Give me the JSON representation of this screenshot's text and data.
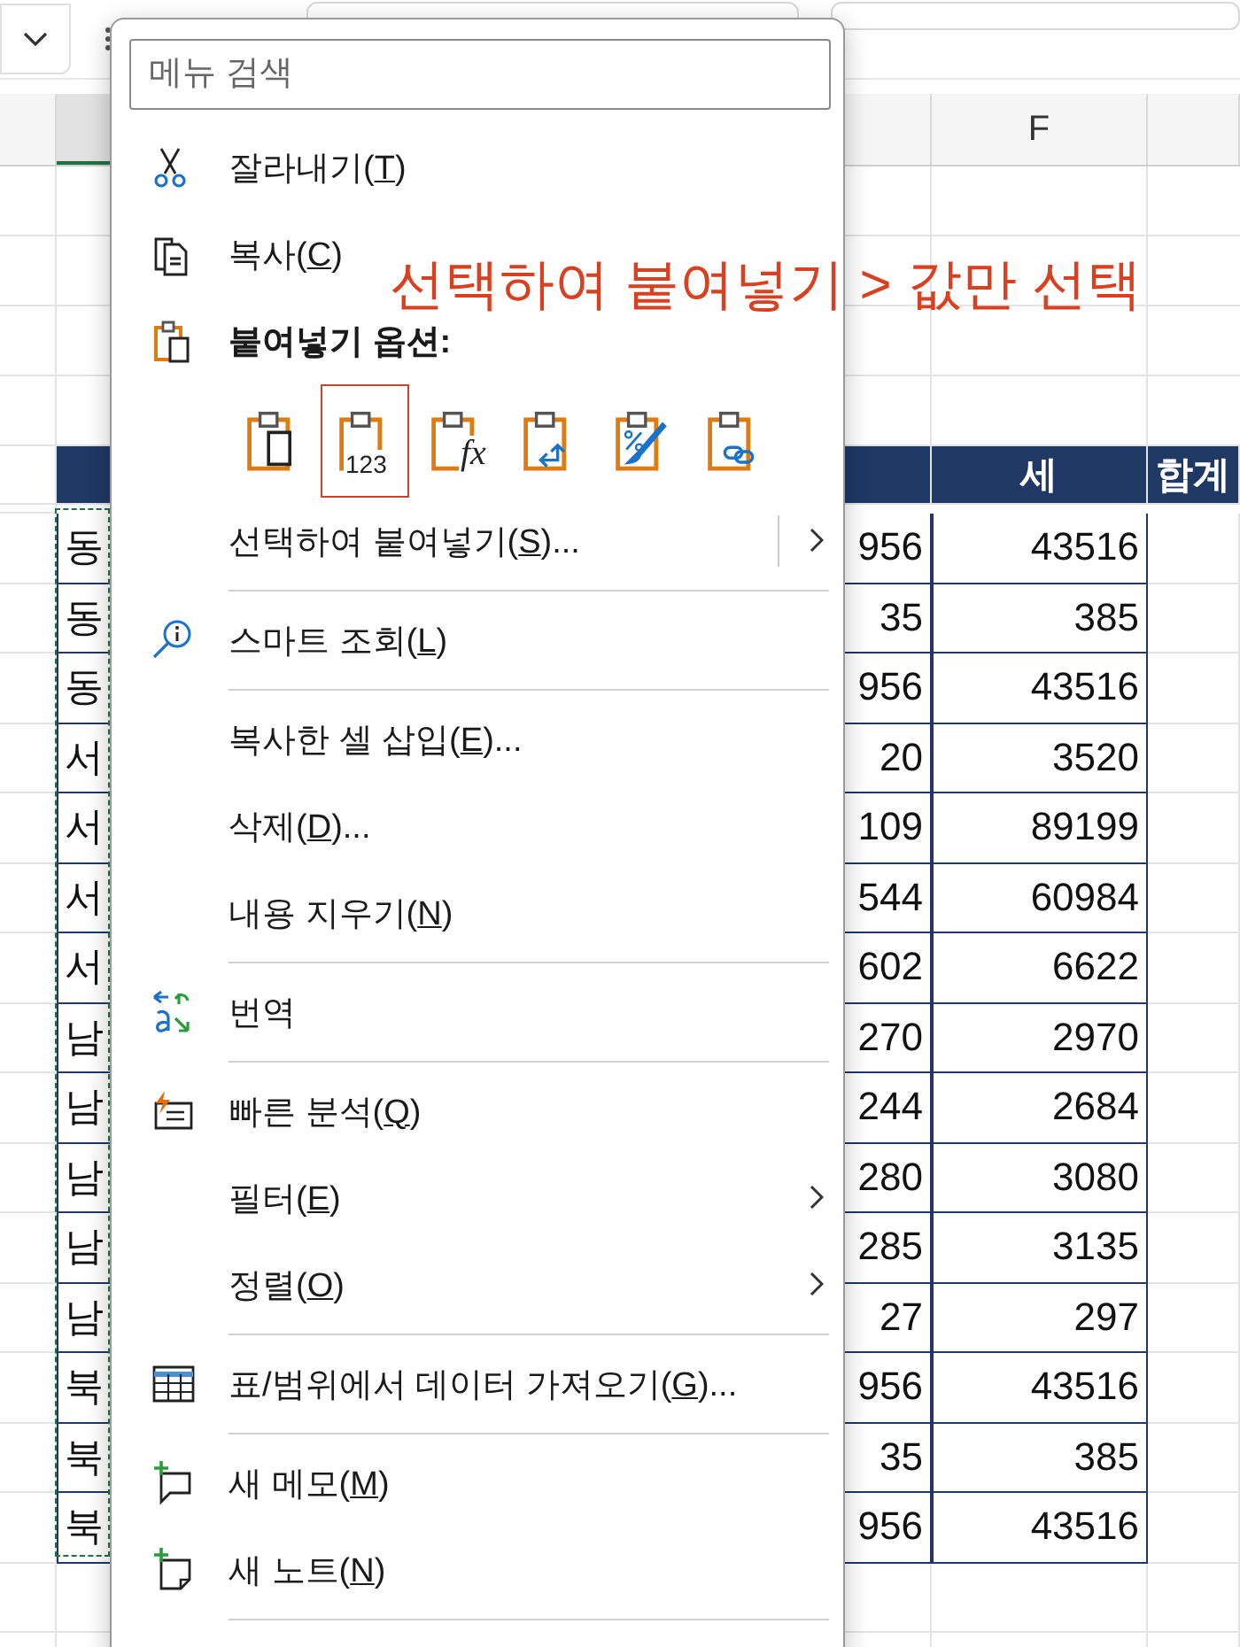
{
  "sheet": {
    "column_header": "F",
    "table_header": [
      "세",
      "합계"
    ],
    "rows": [
      {
        "column_a": "동",
        "column_e": "956",
        "total": "43516"
      },
      {
        "column_a": "동",
        "column_e": "35",
        "total": "385"
      },
      {
        "column_a": "동",
        "column_e": "956",
        "total": "43516"
      },
      {
        "column_a": "서",
        "column_e": "20",
        "total": "3520"
      },
      {
        "column_a": "서",
        "column_e": "109",
        "total": "89199"
      },
      {
        "column_a": "서",
        "column_e": "544",
        "total": "60984"
      },
      {
        "column_a": "서",
        "column_e": "602",
        "total": "6622"
      },
      {
        "column_a": "남",
        "column_e": "270",
        "total": "2970"
      },
      {
        "column_a": "남",
        "column_e": "244",
        "total": "2684"
      },
      {
        "column_a": "남",
        "column_e": "280",
        "total": "3080"
      },
      {
        "column_a": "남",
        "column_e": "285",
        "total": "3135"
      },
      {
        "column_a": "남",
        "column_e": "27",
        "total": "297"
      },
      {
        "column_a": "북",
        "column_e": "956",
        "total": "43516"
      },
      {
        "column_a": "북",
        "column_e": "35",
        "total": "385"
      },
      {
        "column_a": "북",
        "column_e": "956",
        "total": "43516"
      }
    ]
  },
  "context_menu": {
    "search": {
      "placeholder": "메뉴 검색"
    },
    "items": [
      {
        "kind": "item",
        "text": "잘라내기(",
        "key": "T",
        "rest": ")",
        "submenu": false,
        "split": false
      },
      {
        "kind": "item",
        "text": "복사(",
        "key": "C",
        "rest": ")",
        "submenu": false,
        "split": false
      },
      {
        "kind": "heading",
        "text": "붙여넣기 옵션:"
      },
      {
        "kind": "paste_options",
        "options": [
          {
            "annotated": false
          },
          {
            "label": "123",
            "annotated": true
          },
          {
            "label": "fx",
            "annotated": false
          },
          {
            "annotated": false
          },
          {
            "annotated": false
          },
          {
            "annotated": false
          }
        ]
      },
      {
        "kind": "item",
        "text": "선택하여 붙여넣기(",
        "key": "S",
        "rest": ")...",
        "submenu": true,
        "split": true
      },
      {
        "kind": "separator"
      },
      {
        "kind": "item",
        "text": "스마트 조회(",
        "key": "L",
        "rest": ")",
        "submenu": false,
        "split": false
      },
      {
        "kind": "separator"
      },
      {
        "kind": "item",
        "text": "복사한 셀 삽입(",
        "key": "E",
        "rest": ")...",
        "submenu": false,
        "split": false
      },
      {
        "kind": "item",
        "text": "삭제(",
        "key": "D",
        "rest": ")...",
        "submenu": false,
        "split": false
      },
      {
        "kind": "item",
        "text": "내용 지우기(",
        "key": "N",
        "rest": ")",
        "submenu": false,
        "split": false
      },
      {
        "kind": "separator"
      },
      {
        "kind": "item",
        "text": "번역",
        "submenu": false,
        "split": false
      },
      {
        "kind": "separator"
      },
      {
        "kind": "item",
        "text": "빠른 분석(",
        "key": "Q",
        "rest": ")",
        "submenu": false,
        "split": false
      },
      {
        "kind": "item",
        "text": "필터(",
        "key": "E",
        "rest": ")",
        "submenu": true,
        "split": false
      },
      {
        "kind": "item",
        "text": "정렬(",
        "key": "O",
        "rest": ")",
        "submenu": true,
        "split": false
      },
      {
        "kind": "separator"
      },
      {
        "kind": "item",
        "text": "표/범위에서 데이터 가져오기(",
        "key": "G",
        "rest": ")...",
        "submenu": false,
        "split": false
      },
      {
        "kind": "separator"
      },
      {
        "kind": "item",
        "text": "새 메모(",
        "key": "M",
        "rest": ")",
        "submenu": false,
        "split": false
      },
      {
        "kind": "item",
        "text": "새 노트(",
        "key": "N",
        "rest": ")",
        "submenu": false,
        "split": false
      },
      {
        "kind": "separator"
      }
    ]
  },
  "annotation": "선택하여 붙여넣기 > 값만 선택"
}
